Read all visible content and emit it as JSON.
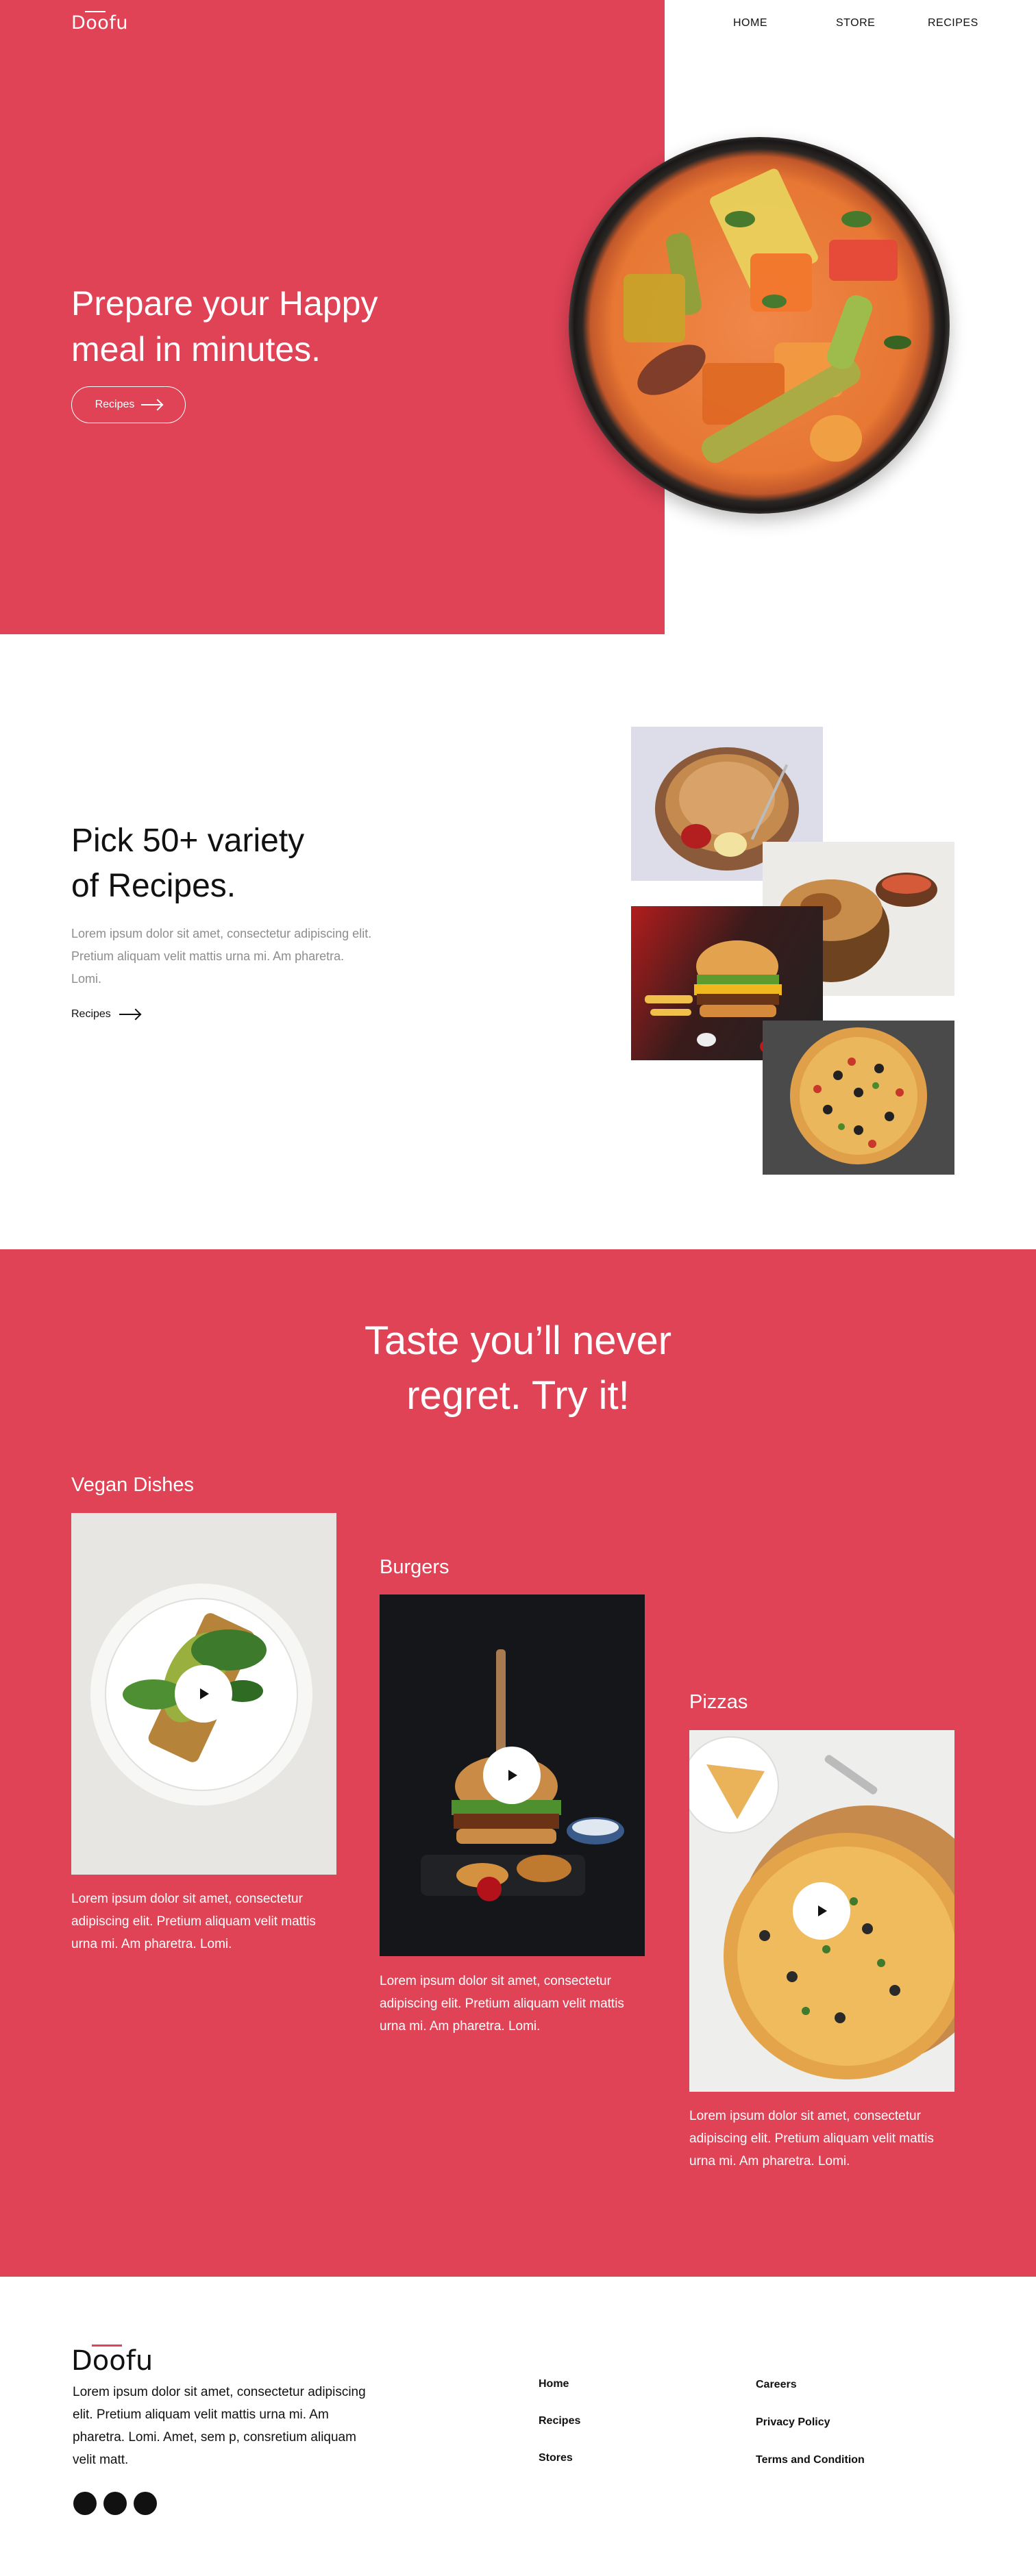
{
  "brand": {
    "logo_text": "Doofu",
    "accent_color": "#e04256"
  },
  "nav": {
    "home": "HOME",
    "store": "STORE",
    "recipes": "RECIPES"
  },
  "hero": {
    "title_line1": "Prepare your Happy",
    "title_line2": "meal in minutes.",
    "button_label": "Recipes",
    "image": "vegetable-curry-bowl"
  },
  "variety": {
    "title_line1": "Pick 50+ variety",
    "title_line2": "of Recipes.",
    "body": "Lorem ipsum dolor sit amet, consectetur adipiscing elit. Pretium aliquam velit mattis urna mi. Am pharetra. Lomi.",
    "link_label": "Recipes",
    "images": [
      "paratha-plate",
      "biryani-bowl",
      "burger",
      "pizza"
    ]
  },
  "taste": {
    "title_line1": "Taste you’ll never",
    "title_line2": "regret. Try it!",
    "categories": [
      {
        "title": "Vegan Dishes",
        "body": "Lorem ipsum dolor sit amet, consectetur adipiscing elit. Pretium aliquam velit mattis urna mi. Am pharetra. Lomi.",
        "image": "avocado-toast-plate"
      },
      {
        "title": "Burgers",
        "body": "Lorem ipsum dolor sit amet, consectetur adipiscing elit. Pretium aliquam velit mattis urna mi. Am pharetra. Lomi.",
        "image": "burger-fries"
      },
      {
        "title": "Pizzas",
        "body": "Lorem ipsum dolor sit amet, consectetur adipiscing elit. Pretium aliquam velit mattis urna mi. Am pharetra. Lomi.",
        "image": "pizza-board"
      }
    ]
  },
  "footer": {
    "logo_text": "Doofu",
    "body": "Lorem ipsum dolor sit amet, consectetur adipiscing elit. Pretium aliquam velit mattis urna mi. Am pharetra. Lomi. Amet, sem p, consretium aliquam velit matt.",
    "col1": [
      "Home",
      "Recipes",
      "Stores"
    ],
    "col2": [
      "Careers",
      "Privacy Policy",
      "Terms and Condition"
    ],
    "social_icons": [
      "social-icon-1",
      "social-icon-2",
      "social-icon-3"
    ]
  }
}
